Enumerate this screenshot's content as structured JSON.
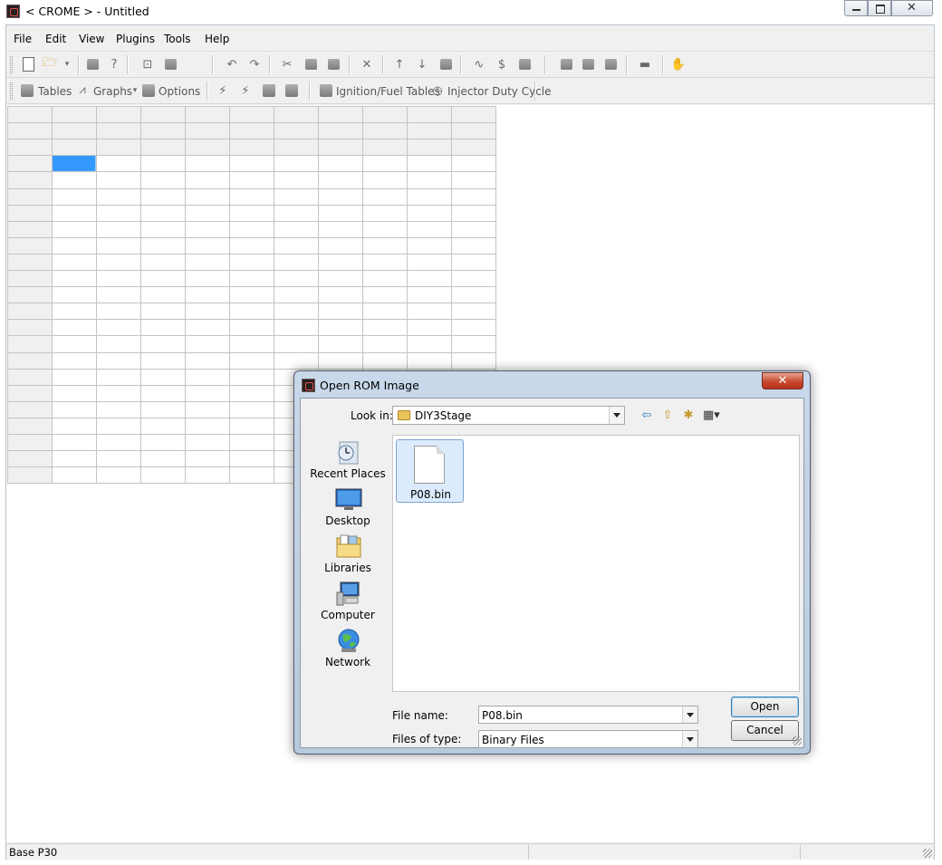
{
  "window": {
    "title": "< CROME > - Untitled"
  },
  "menu": [
    "File",
    "Edit",
    "View",
    "Plugins",
    "Tools",
    "Help"
  ],
  "toolbar2": {
    "tables": "Tables",
    "graphs": "Graphs",
    "options": "Options",
    "ignition_fuel": "Ignition/Fuel Tables",
    "injector_duty": "Injector Duty Cycle"
  },
  "status": {
    "left": "Base P30"
  },
  "dialog": {
    "title": "Open ROM Image",
    "look_in_label": "Look in:",
    "look_in_value": "DIY3Stage",
    "places": [
      "Recent Places",
      "Desktop",
      "Libraries",
      "Computer",
      "Network"
    ],
    "files": [
      {
        "name": "P08.bin",
        "selected": true
      }
    ],
    "file_name_label": "File name:",
    "file_name_value": "P08.bin",
    "file_type_label": "Files of type:",
    "file_type_value": "Binary Files",
    "open_label": "Open",
    "cancel_label": "Cancel"
  },
  "colors": {
    "selection": "#3399ff",
    "dialog_frame": "#b9cde1"
  }
}
